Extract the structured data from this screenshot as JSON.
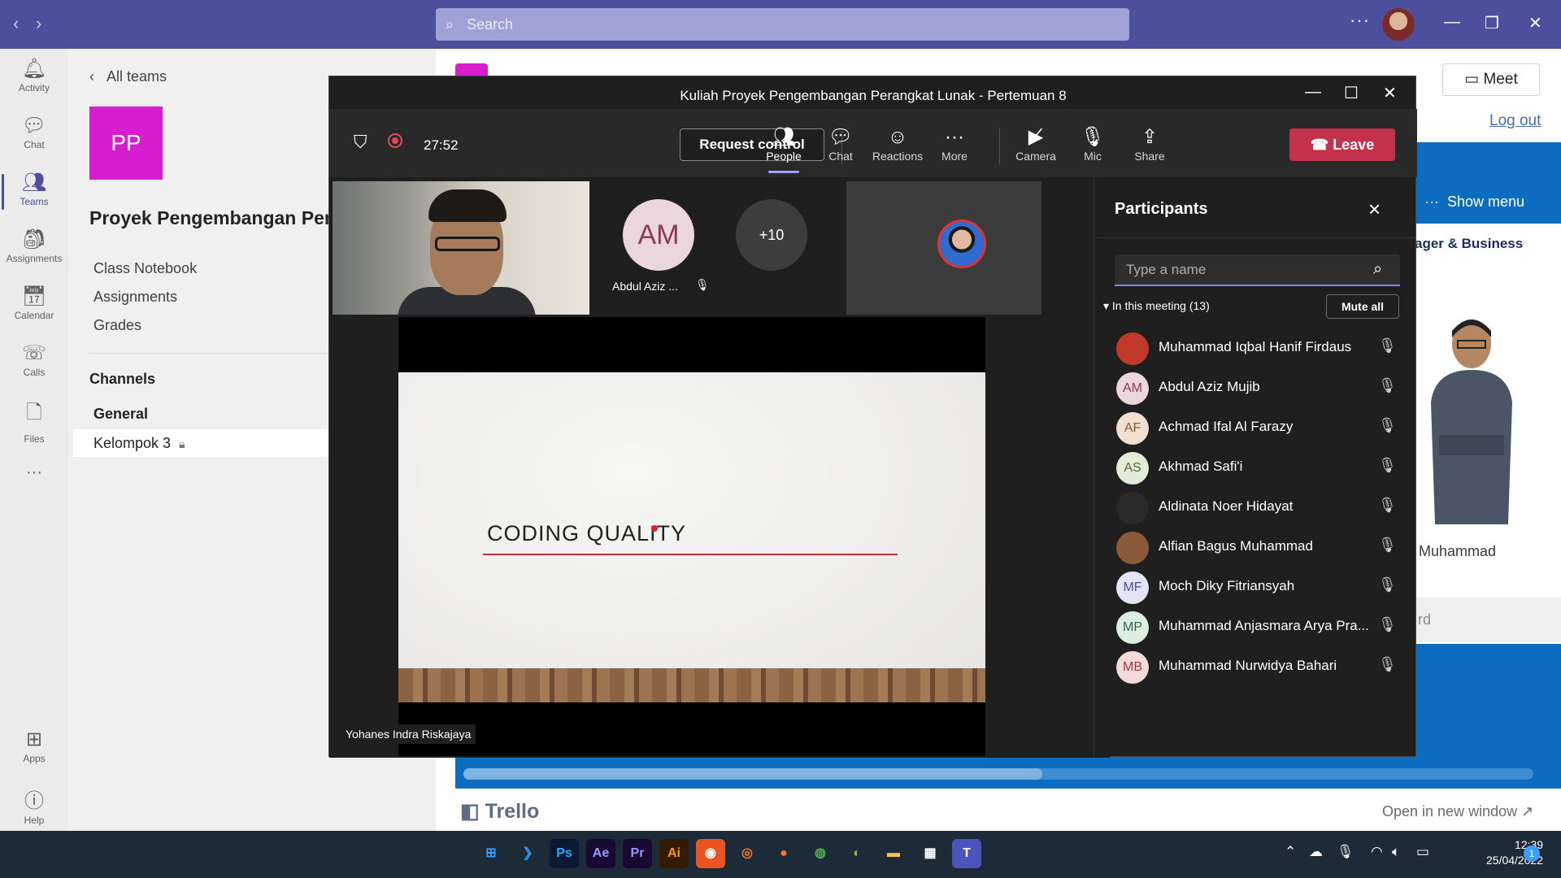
{
  "titlebar": {
    "search_placeholder": "Search",
    "more": "···"
  },
  "rail": {
    "items": [
      {
        "label": "Activity",
        "icon": "bell-icon"
      },
      {
        "label": "Chat",
        "icon": "chat-icon"
      },
      {
        "label": "Teams",
        "icon": "teams-icon"
      },
      {
        "label": "Assignments",
        "icon": "assignments-icon"
      },
      {
        "label": "Calendar",
        "icon": "calendar-icon"
      },
      {
        "label": "Calls",
        "icon": "phone-icon"
      },
      {
        "label": "Files",
        "icon": "file-icon"
      },
      {
        "label": "···",
        "icon": "more-icon"
      },
      {
        "label": "Apps",
        "icon": "apps-icon"
      },
      {
        "label": "Help",
        "icon": "help-icon"
      }
    ],
    "active": "Teams"
  },
  "team_panel": {
    "all_teams": "All teams",
    "avatar_initials": "PP",
    "team_name": "Proyek Pengembangan Pera",
    "links": [
      "Class Notebook",
      "Assignments",
      "Grades"
    ],
    "channels_heading": "Channels",
    "channels": [
      "General",
      "Kelompok 3"
    ]
  },
  "background": {
    "meet_label": "Meet",
    "logout": "Log out",
    "show_menu": "Show menu",
    "manager_text": "ager & Business",
    "person_name": "Muhammad",
    "grey_strip_text": "rd",
    "trello": "Trello",
    "open_new_window": "Open in new window ↗"
  },
  "meeting": {
    "title": "Kuliah Proyek Pengembangan Perangkat Lunak - Pertemuan 8",
    "timer": "27:52",
    "request_control": "Request control",
    "toolbar": [
      {
        "label": "People",
        "icon": "people-icon",
        "active": true
      },
      {
        "label": "Chat",
        "icon": "chat-icon",
        "active": false
      },
      {
        "label": "Reactions",
        "icon": "reactions-icon",
        "active": false
      },
      {
        "label": "More",
        "icon": "more-icon",
        "active": false
      },
      {
        "label": "Camera",
        "icon": "camera-off-icon",
        "active": false
      },
      {
        "label": "Mic",
        "icon": "mic-off-icon",
        "active": false
      },
      {
        "label": "Share",
        "icon": "share-icon",
        "active": false
      }
    ],
    "leave": "Leave",
    "tiles": {
      "am_initials": "AM",
      "am_name": "Abdul Aziz ...",
      "overflow": "+10"
    },
    "slide_title": "CODING QUALITY",
    "presenter": "Yohanes Indra Riskajaya"
  },
  "participants": {
    "title": "Participants",
    "search_placeholder": "Type a name",
    "section": "In this meeting (13)",
    "mute_all": "Mute all",
    "people": [
      {
        "initials": "",
        "name": "Muhammad Iqbal Hanif Firdaus",
        "avatar_color": "#c0392b",
        "fg": "#ffffff"
      },
      {
        "initials": "AM",
        "name": "Abdul Aziz Mujib",
        "avatar_color": "#ecd6de",
        "fg": "#8a3a57"
      },
      {
        "initials": "AF",
        "name": "Achmad Ifal Al Farazy",
        "avatar_color": "#f1dfd2",
        "fg": "#8a5a3a"
      },
      {
        "initials": "AS",
        "name": "Akhmad Safi'i",
        "avatar_color": "#e2ecd9",
        "fg": "#4d6b35"
      },
      {
        "initials": "",
        "name": "Aldinata Noer Hidayat",
        "avatar_color": "#2a2a2a",
        "fg": "#ffffff"
      },
      {
        "initials": "",
        "name": "Alfian Bagus Muhammad",
        "avatar_color": "#8a5a3a",
        "fg": "#ffffff"
      },
      {
        "initials": "MF",
        "name": "Moch Diky Fitriansyah",
        "avatar_color": "#e3e4f5",
        "fg": "#4b4f9c"
      },
      {
        "initials": "MP",
        "name": "Muhammad Anjasmara Arya Pra...",
        "avatar_color": "#dceee1",
        "fg": "#2e6b45"
      },
      {
        "initials": "MB",
        "name": "Muhammad Nurwidya Bahari",
        "avatar_color": "#f5dada",
        "fg": "#9c3a3a"
      }
    ]
  },
  "taskbar": {
    "apps": [
      {
        "name": "windows-start-icon",
        "label": "⊞",
        "bg": "#1d2a38",
        "fg": "#3aa0ff"
      },
      {
        "name": "vscode-icon",
        "label": "❯",
        "bg": "#1d2a38",
        "fg": "#2d8ee0"
      },
      {
        "name": "photoshop-icon",
        "label": "Ps",
        "bg": "#0a1a33",
        "fg": "#31a8ff"
      },
      {
        "name": "after-effects-icon",
        "label": "Ae",
        "bg": "#1a0a33",
        "fg": "#9999ff"
      },
      {
        "name": "premiere-icon",
        "label": "Pr",
        "bg": "#1a0a33",
        "fg": "#9999ff"
      },
      {
        "name": "illustrator-icon",
        "label": "Ai",
        "bg": "#331a00",
        "fg": "#ff9a00"
      },
      {
        "name": "ubuntu-icon",
        "label": "◉",
        "bg": "#e95420",
        "fg": "#ffffff"
      },
      {
        "name": "blender-icon",
        "label": "◎",
        "bg": "#1d2a38",
        "fg": "#f5792a"
      },
      {
        "name": "firefox-icon",
        "label": "●",
        "bg": "#1d2a38",
        "fg": "#ff7139"
      },
      {
        "name": "chrome-icon",
        "label": "◍",
        "bg": "#1d2a38",
        "fg": "#4caf50"
      },
      {
        "name": "globe-app-icon",
        "label": "◐",
        "bg": "#1d2a38",
        "fg": "#7cc142"
      },
      {
        "name": "file-explorer-icon",
        "label": "▬",
        "bg": "#1d2a38",
        "fg": "#f8c642"
      },
      {
        "name": "store-icon",
        "label": "▦",
        "bg": "#1d2a38",
        "fg": "#ffffff"
      },
      {
        "name": "teams-app-icon",
        "label": "T",
        "bg": "#4b53bc",
        "fg": "#ffffff"
      }
    ],
    "time": "12:39",
    "date": "25/04/2022",
    "notifications": "1"
  }
}
